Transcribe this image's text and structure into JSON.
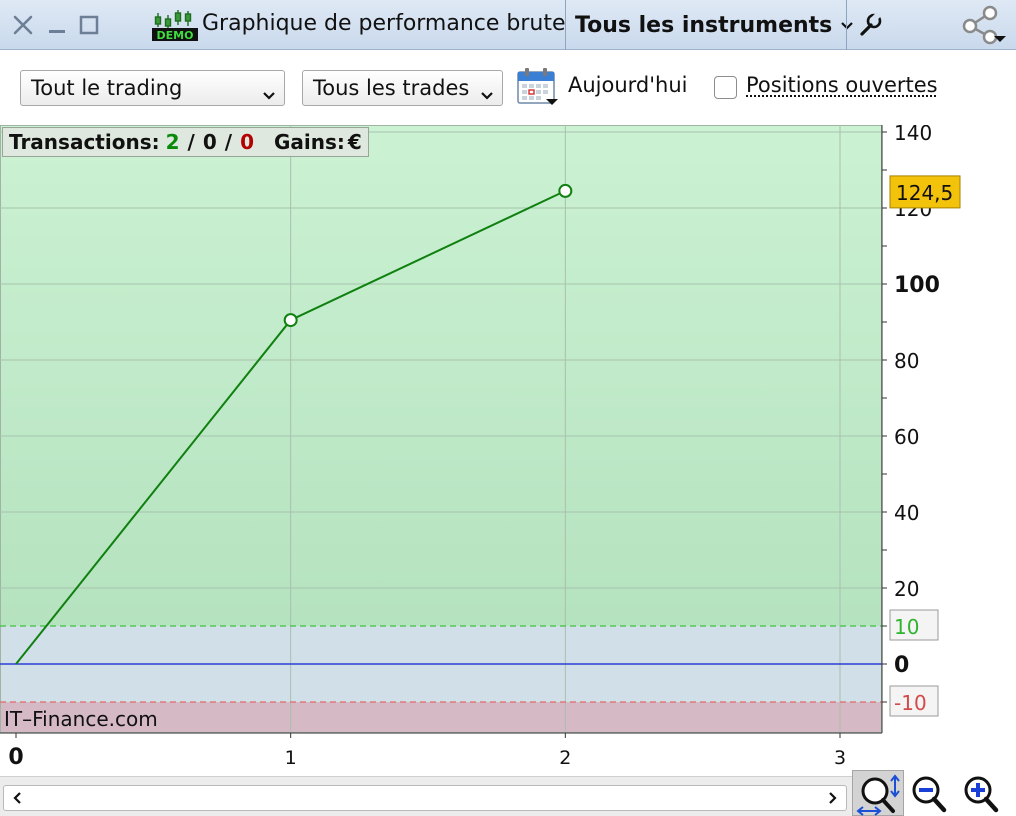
{
  "window": {
    "title": "Graphique de performance brute",
    "demo_badge": "DEMO",
    "instrument_selector": "Tous les instruments"
  },
  "toolbar": {
    "trading_filter": "Tout le trading",
    "trades_filter": "Tous les trades",
    "today_label": "Aujourd'hui",
    "open_positions_label": "Positions ouvertes",
    "open_positions_checked": false
  },
  "stats": {
    "transactions_label": "Transactions:",
    "wins": "2",
    "sep1": "/",
    "neutral": "0",
    "sep2": "/",
    "losses": "0",
    "gains_label": "Gains:",
    "currency": "€"
  },
  "watermark": "IT–Finance.com",
  "colors": {
    "win": "#0a8a0a",
    "loss": "#b40000",
    "line": "#108010",
    "zero_line": "#2a3fd6",
    "upper_zone": "#c5edce",
    "neutral_zone": "#d1dfe8",
    "lower_zone": "#d5b9c4",
    "last_value_badge": "#f3c20a"
  },
  "chart_data": {
    "type": "line",
    "x": [
      0,
      1,
      2
    ],
    "values": [
      0,
      90.5,
      124.5
    ],
    "xlim": [
      0,
      3
    ],
    "ylim": [
      -18,
      143
    ],
    "x_ticks": [
      "0",
      "1",
      "2",
      "3"
    ],
    "y_ticks": [
      "140",
      "120",
      "100",
      "80",
      "60",
      "40",
      "20",
      "0"
    ],
    "upper_threshold": 10,
    "lower_threshold": -10,
    "upper_threshold_label": "10",
    "lower_threshold_label": "-10",
    "last_value_label": "124,5",
    "grid": true
  }
}
